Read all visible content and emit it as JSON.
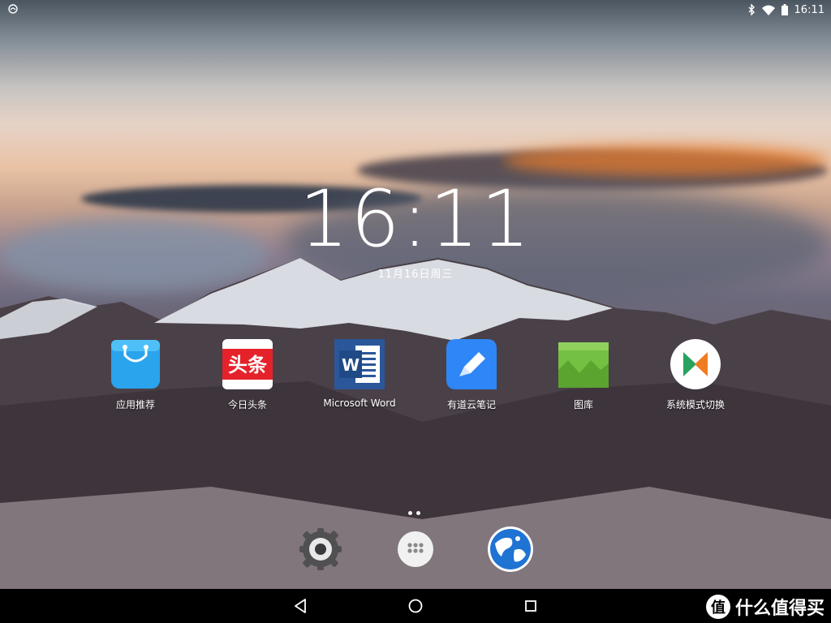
{
  "status_bar": {
    "time": "16:11",
    "icons": [
      "notification-icon",
      "bluetooth-icon",
      "wifi-icon",
      "battery-icon"
    ]
  },
  "lockclock": {
    "time": "16:11",
    "date": "11月16日周三"
  },
  "apps": [
    {
      "label": "应用推荐",
      "icon": "shopping-bag-icon"
    },
    {
      "label": "今日头条",
      "icon": "toutiao-icon"
    },
    {
      "label": "Microsoft Word",
      "icon": "word-icon"
    },
    {
      "label": "有道云笔记",
      "icon": "note-pencil-icon"
    },
    {
      "label": "图库",
      "icon": "gallery-icon"
    },
    {
      "label": "系统模式切换",
      "icon": "mode-switch-icon"
    }
  ],
  "toutiao_badge": "头条",
  "dock": [
    {
      "icon": "settings-gear-icon"
    },
    {
      "icon": "app-drawer-icon"
    },
    {
      "icon": "globe-browser-icon"
    }
  ],
  "navbar": {
    "icons": [
      "back-icon",
      "home-icon",
      "recents-icon"
    ]
  },
  "watermark": {
    "badge": "值",
    "text": "什么值得买"
  },
  "colors": {
    "navbar": "#000000",
    "appstore_blue": "#2aa4ec",
    "toutiao_red": "#e5222a",
    "word_blue": "#2b579a",
    "youdao_blue": "#2f86f6",
    "gallery_green": "#74c043"
  }
}
